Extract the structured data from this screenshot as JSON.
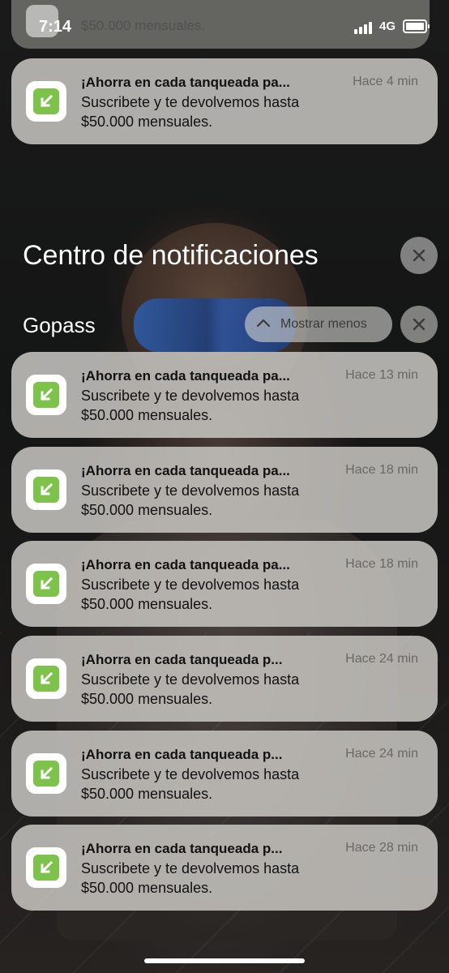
{
  "status_bar": {
    "time": "7:14",
    "network": "4G"
  },
  "top_partial_text": "$50.000 mensuales.",
  "top_notification": {
    "title": "¡Ahorra en cada tanqueada pa...",
    "time": "Hace 4 min",
    "body_line1": "Suscribete y te devolvemos hasta",
    "body_line2": "$50.000 mensuales."
  },
  "center_title": "Centro de notificaciones",
  "group": {
    "name": "Gopass",
    "show_less_label": "Mostrar menos"
  },
  "notifications": [
    {
      "title": "¡Ahorra en cada tanqueada pa...",
      "time": "Hace 13 min",
      "body_line1": "Suscribete y te devolvemos hasta",
      "body_line2": "$50.000 mensuales."
    },
    {
      "title": "¡Ahorra en cada tanqueada pa...",
      "time": "Hace 18 min",
      "body_line1": "Suscribete y te devolvemos hasta",
      "body_line2": "$50.000 mensuales."
    },
    {
      "title": "¡Ahorra en cada tanqueada pa...",
      "time": "Hace 18 min",
      "body_line1": "Suscribete y te devolvemos hasta",
      "body_line2": "$50.000 mensuales."
    },
    {
      "title": "¡Ahorra en cada tanqueada p...",
      "time": "Hace 24 min",
      "body_line1": "Suscribete y te devolvemos hasta",
      "body_line2": "$50.000 mensuales."
    },
    {
      "title": "¡Ahorra en cada tanqueada p...",
      "time": "Hace 24 min",
      "body_line1": "Suscribete y te devolvemos hasta",
      "body_line2": "$50.000 mensuales."
    },
    {
      "title": "¡Ahorra en cada tanqueada p...",
      "time": "Hace 28 min",
      "body_line1": "Suscribete y te devolvemos hasta",
      "body_line2": "$50.000 mensuales."
    }
  ],
  "colors": {
    "app_icon_green": "#7dc24b",
    "card_bg": "#c8c6c1",
    "text_primary": "#121212",
    "text_secondary": "#6a6866"
  },
  "icons": {
    "app": "gopass-arrow-icon",
    "close": "close-icon",
    "collapse": "chevron-up-icon",
    "signal": "signal-bars-icon",
    "battery": "battery-icon"
  }
}
